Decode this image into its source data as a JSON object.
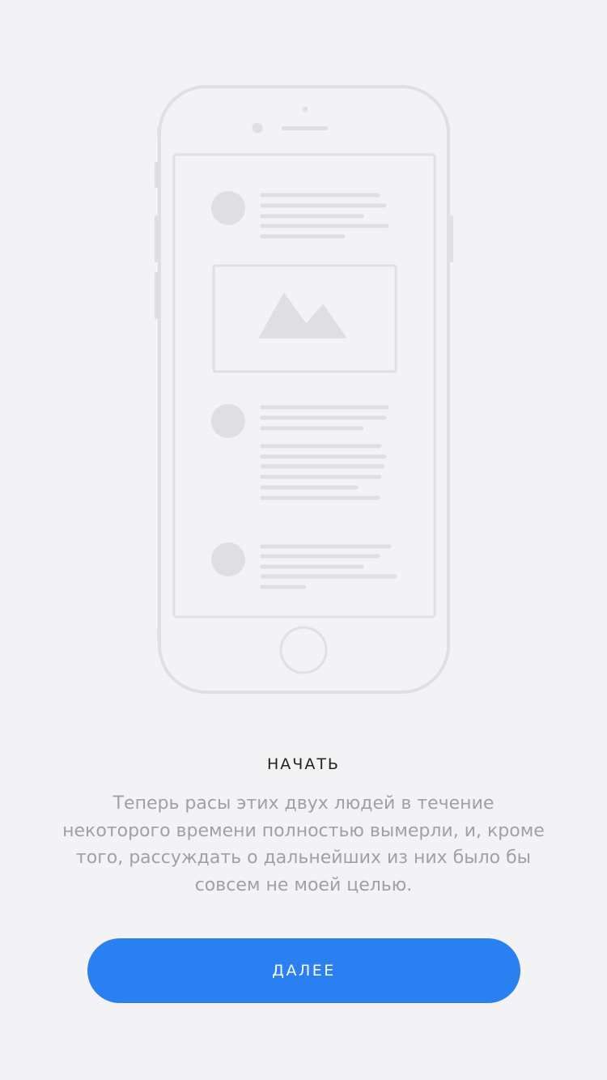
{
  "onboarding": {
    "title": "НАЧАТЬ",
    "description": "Теперь расы этих двух людей в течение некоторого времени полностью вымерли, и, кроме того, рассуждать о дальнейших из них было бы совсем не моей целью.",
    "next_button_label": "ДАЛЕЕ"
  },
  "colors": {
    "background": "#f3f3f6",
    "illustration_stroke": "#e0e0e2",
    "illustration_fill": "#dfdfe1",
    "title": "#222222",
    "description": "#a0a0a8",
    "accent": "#2a7ff1",
    "button_text": "#ffffff"
  },
  "icons": [
    "phone-frame-icon",
    "avatar-placeholder-icon",
    "image-placeholder-icon",
    "home-button-icon"
  ]
}
